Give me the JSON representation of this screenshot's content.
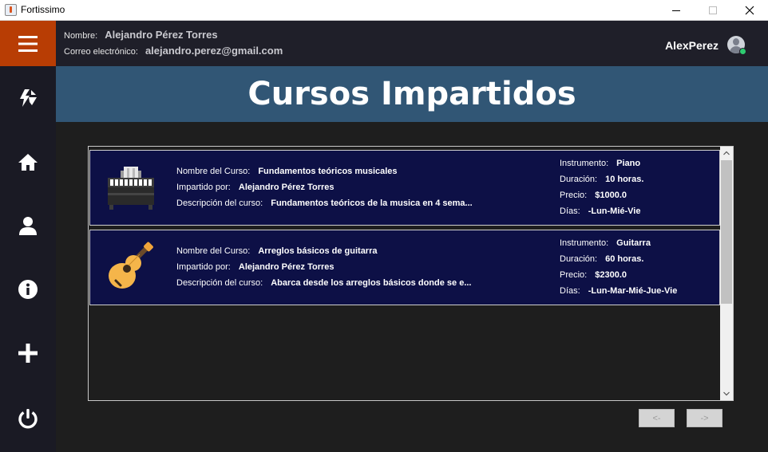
{
  "window": {
    "title": "Fortissimo"
  },
  "header": {
    "name_label": "Nombre:",
    "name_value": "Alejandro Pérez Torres",
    "email_label": "Correo electrónico:",
    "email_value": "alejandro.perez@gmail.com",
    "username": "AlexPerez"
  },
  "sidebar": {
    "items": [
      {
        "icon": "hamburger-menu-icon"
      },
      {
        "icon": "sync-arrows-icon"
      },
      {
        "icon": "home-icon"
      },
      {
        "icon": "user-icon"
      },
      {
        "icon": "info-icon"
      },
      {
        "icon": "plus-icon"
      },
      {
        "icon": "power-icon"
      }
    ],
    "accent_color": "#b83d04"
  },
  "banner": {
    "title": "Cursos Impartidos",
    "color": "#315675"
  },
  "courses": [
    {
      "icon": "piano-icon",
      "name_label": "Nombre del Curso:",
      "name": "Fundamentos teóricos musicales",
      "teacher_label": "Impartido por:",
      "teacher": "Alejandro Pérez Torres",
      "desc_label": "Descripción del curso:",
      "desc": "Fundamentos teóricos de la musica en 4 sema...",
      "instrument_label": "Instrumento:",
      "instrument": "Piano",
      "duration_label": "Duración:",
      "duration": "10 horas.",
      "price_label": "Precio:",
      "price": "$1000.0",
      "days_label": "Días:",
      "days": "-Lun-Mié-Vie"
    },
    {
      "icon": "guitar-icon",
      "name_label": "Nombre del Curso:",
      "name": "Arreglos básicos de guitarra",
      "teacher_label": "Impartido por:",
      "teacher": "Alejandro Pérez Torres",
      "desc_label": "Descripción del curso:",
      "desc": "Abarca desde los arreglos básicos donde se e...",
      "instrument_label": "Instrumento:",
      "instrument": "Guitarra",
      "duration_label": "Duración:",
      "duration": "60 horas.",
      "price_label": "Precio:",
      "price": "$2300.0",
      "days_label": "Días:",
      "days": "-Lun-Mar-Mié-Jue-Vie"
    }
  ],
  "pager": {
    "prev_label": "<-",
    "next_label": "->"
  }
}
